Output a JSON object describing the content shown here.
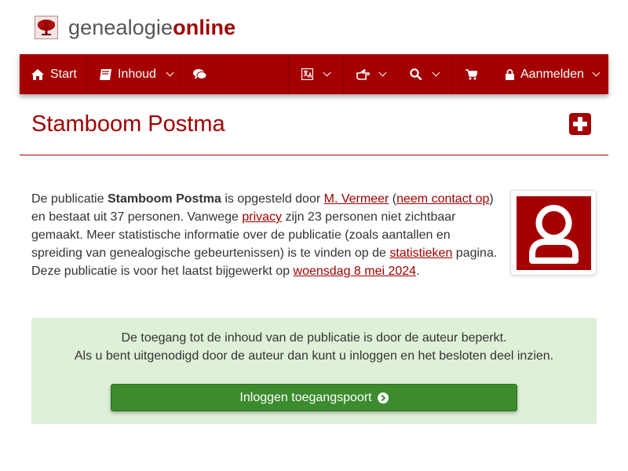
{
  "site": {
    "logo_part1": "genealogie",
    "logo_part2": "online",
    "logo_icon": "tree-icon"
  },
  "colors": {
    "brand_red": "#a50000",
    "nav_text": "#ffffff",
    "access_bg": "#dff0d8",
    "button_green": "#3c8b2f"
  },
  "nav": {
    "start_label": "Start",
    "start_icon": "home-icon",
    "inhoud_label": "Inhoud",
    "inhoud_icon": "book-icon",
    "comments_icon": "comments-icon",
    "language_icon": "language-icon",
    "share_icon": "hand-pointing-icon",
    "search_icon": "search-icon",
    "cart_icon": "cart-icon",
    "login_label": "Aanmelden",
    "login_icon": "lock-icon"
  },
  "page": {
    "title": "Stamboom Postma",
    "add_icon": "plus-square-icon"
  },
  "intro": {
    "t1": "De publicatie ",
    "pub_name": "Stamboom Postma",
    "t2": " is opgesteld door ",
    "author": "M. Vermeer",
    "t3": " (",
    "contact": "neem contact op",
    "t4": ") en bestaat uit 37 personen. Vanwege ",
    "privacy": "privacy",
    "t5": " zijn 23 personen niet zichtbaar gemaakt. Meer statistische informatie over de publicatie (zoals aantallen en spreiding van genealogische gebeurtenissen) is te vinden op de ",
    "stats": "statistieken",
    "t6": " pagina. Deze publicatie is voor het laatst bijgewerkt op ",
    "updated": "woensdag 8 mei 2024",
    "t7": "."
  },
  "avatar": {
    "icon": "user-icon"
  },
  "access": {
    "line1": "De toegang tot de inhoud van de publicatie is door de auteur beperkt.",
    "line2": "Als u bent uitgenodigd door de auteur dan kunt u inloggen en het besloten deel inzien.",
    "button_label": "Inloggen toegangspoort",
    "button_icon": "arrow-circle-right-icon"
  }
}
